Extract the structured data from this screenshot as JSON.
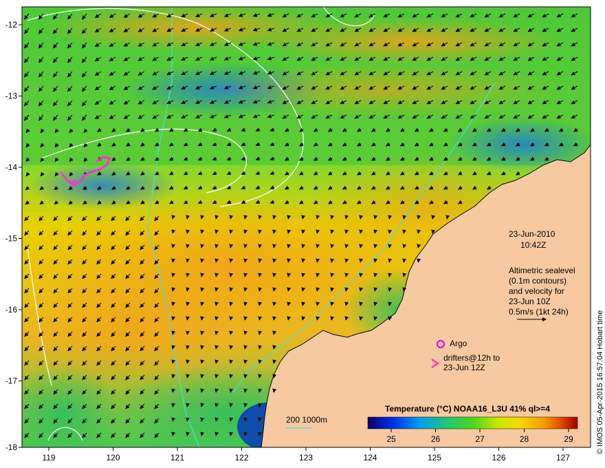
{
  "map": {
    "lon_ticks": [
      "119",
      "120",
      "121",
      "122",
      "123",
      "124",
      "125",
      "126",
      "127"
    ],
    "lat_ticks": [
      "-12",
      "-13",
      "-14",
      "-15",
      "-16",
      "-17",
      "-18"
    ],
    "date_line1": "23-Jun-2010",
    "date_line2": "10:42Z",
    "altimetry_lines": [
      "Altimetric sealevel",
      "(0.1m contours)",
      "and velocity for",
      "23-Jun 10Z",
      "0.5m/s (1kt 24h)"
    ],
    "argo_label": "Argo",
    "drifter_line1": "drifters@12h to",
    "drifter_line2": "23-Jun 12Z",
    "bathy_label": "200 1000m",
    "credit": "© IMOS 05-Apr-2015 16:57:04 Hobart time",
    "colorbar_title": "Temperature (°C) NOAA16_L3U 41% ql>=4",
    "colorbar_ticks": [
      "25",
      "26",
      "27",
      "28",
      "29"
    ],
    "colors": {
      "land": "#f7c9a0",
      "argo": "#e000e0",
      "drifter": "#ff33cc",
      "bathy_200": "#46e0e0",
      "contour": "#ffffff"
    },
    "icons": [
      "velocity-arrow-icon",
      "argo-float-icon",
      "drifter-chevron-icon"
    ]
  }
}
